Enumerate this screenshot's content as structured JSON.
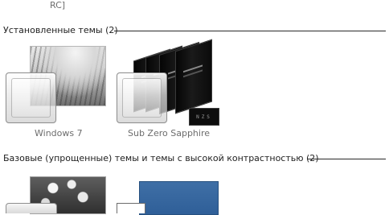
{
  "top_cut_text": "RC]",
  "sections": [
    {
      "title": "Установленные темы (2)"
    },
    {
      "title": "Базовые (упрощенные) темы и темы с высокой контрастностью (2)"
    }
  ],
  "installed_themes": [
    {
      "name": "Windows 7"
    },
    {
      "name": "Sub Zero Sapphire"
    }
  ],
  "sapphire_badge_text": "NZS"
}
